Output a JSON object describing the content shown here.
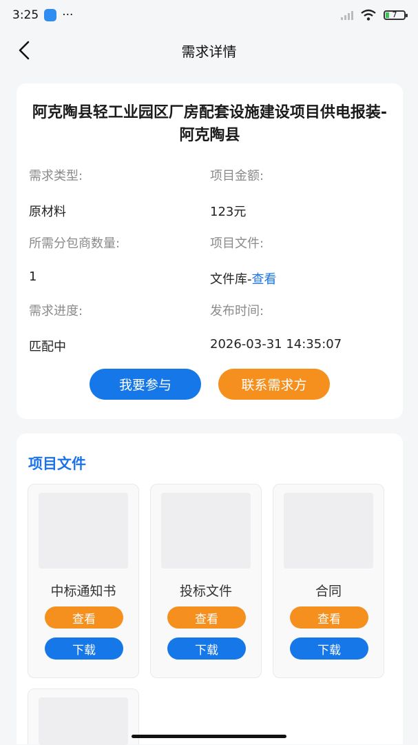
{
  "status": {
    "time": "3:25",
    "dots": "···",
    "battery": "7"
  },
  "nav": {
    "title": "需求详情"
  },
  "detail": {
    "title": "阿克陶县轻工业园区厂房配套设施建设项目供电报装-阿克陶县",
    "fields": [
      {
        "label": "需求类型:",
        "value": "原材料"
      },
      {
        "label": "项目金额:",
        "value": "123元"
      },
      {
        "label": "所需分包商数量:",
        "value": "1"
      },
      {
        "label": "项目文件:",
        "value_prefix": "文件库-",
        "value_link": "查看"
      },
      {
        "label": "需求进度:",
        "value": "匹配中"
      },
      {
        "label": "发布时间:",
        "value": "2026-03-31 14:35:07"
      }
    ],
    "join_label": "我要参与",
    "contact_label": "联系需求方"
  },
  "files": {
    "section_title": "项目文件",
    "items": [
      {
        "name": "中标通知书",
        "view": "查看",
        "download": "下载"
      },
      {
        "name": "投标文件",
        "view": "查看",
        "download": "下载"
      },
      {
        "name": "合同",
        "view": "查看",
        "download": "下载"
      }
    ]
  },
  "colors": {
    "accent_blue": "#1677e8",
    "accent_orange": "#f5901e",
    "link_blue": "#1a73e8"
  }
}
